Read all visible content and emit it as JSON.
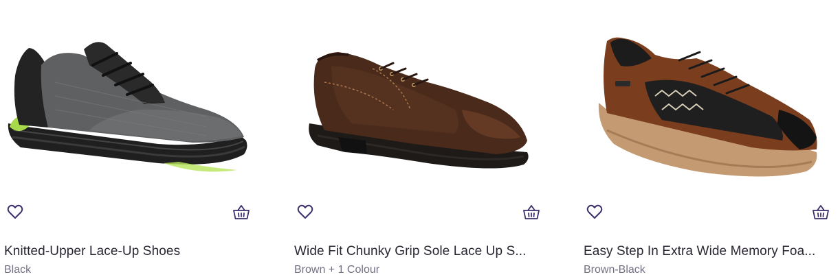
{
  "theme": {
    "icon_color": "#3b2d6b",
    "title_color": "#2a2633",
    "subtitle_color": "#747083"
  },
  "products": [
    {
      "title": "Knitted-Upper Lace-Up Shoes",
      "colour": "Black",
      "wishlist_icon": "heart-outline-icon",
      "basket_icon": "basket-icon"
    },
    {
      "title": "Wide Fit Chunky Grip Sole Lace Up S...",
      "colour": "Brown + 1 Colour",
      "wishlist_icon": "heart-outline-icon",
      "basket_icon": "basket-icon"
    },
    {
      "title": "Easy Step In Extra Wide Memory Foa...",
      "colour": "Brown-Black",
      "wishlist_icon": "heart-outline-icon",
      "basket_icon": "basket-icon"
    }
  ]
}
